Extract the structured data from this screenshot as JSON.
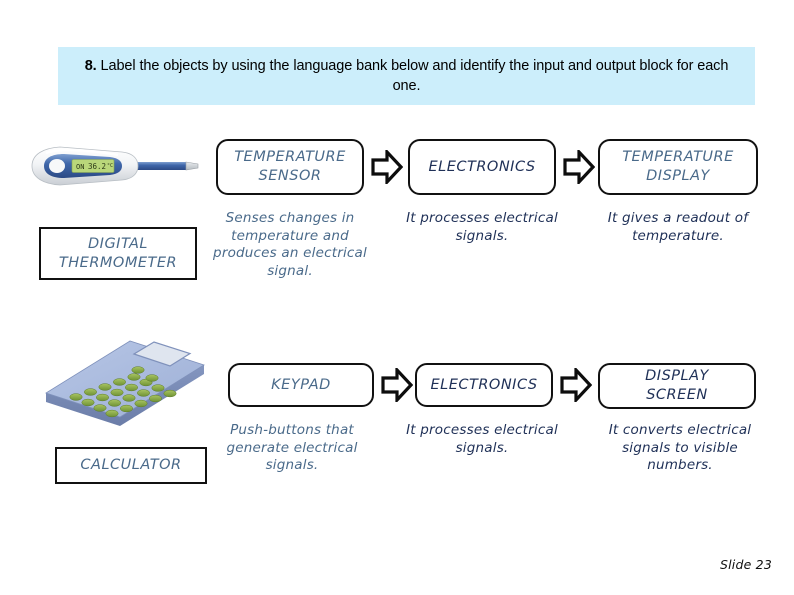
{
  "header": {
    "number": "8.",
    "text": " Label the objects by using the language bank below and identify the input and output block for each one.",
    "background": "#CCEEFB"
  },
  "colors": {
    "dark_navy": "#1F3057",
    "mid_blue": "#4A6A8A",
    "border": "#111111",
    "banner_bg": "#CCEEFB"
  },
  "rows": [
    {
      "device": {
        "name": "DIGITAL\nTHERMOMETER",
        "line1": "DIGITAL",
        "line2": "THERMOMETER",
        "image": "digital-thermometer-image"
      },
      "blocks": [
        {
          "title_line1": "TEMPERATURE",
          "title_line2": "SENSOR",
          "title_color": "#4A6A8A",
          "description": "Senses changes in temperature and produces an electrical signal.",
          "desc_color": "#4A6A8A"
        },
        {
          "title_line1": "ELECTRONICS",
          "title_line2": "",
          "title_color": "#1F3057",
          "description": "It processes electrical signals.",
          "desc_color": "#1F3057"
        },
        {
          "title_line1": "TEMPERATURE",
          "title_line2": "DISPLAY",
          "title_color": "#4A6A8A",
          "description": "It gives a readout of temperature.",
          "desc_color": "#1F3057"
        }
      ]
    },
    {
      "device": {
        "name": "CALCULATOR",
        "line1": "CALCULATOR",
        "line2": "",
        "image": "calculator-image"
      },
      "blocks": [
        {
          "title_line1": "KEYPAD",
          "title_line2": "",
          "title_color": "#4A6A8A",
          "description": "Push-buttons that generate electrical signals.",
          "desc_color": "#4A6A8A"
        },
        {
          "title_line1": "ELECTRONICS",
          "title_line2": "",
          "title_color": "#1F3057",
          "description": "It processes electrical signals.",
          "desc_color": "#1F3057"
        },
        {
          "title_line1": "DISPLAY",
          "title_line2": "SCREEN",
          "title_color": "#1F3057",
          "description": "It converts electrical signals to visible numbers.",
          "desc_color": "#1F3057"
        }
      ]
    }
  ],
  "arrows": {
    "icon": "block-arrow-right-icon",
    "count": 4
  },
  "thermometer": {
    "display_value": "36.2",
    "unit": "°C"
  },
  "footer": {
    "slide_label": "Slide 23"
  }
}
